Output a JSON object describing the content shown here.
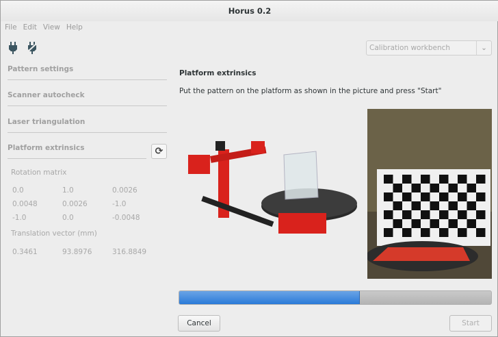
{
  "window": {
    "title": "Horus 0.2"
  },
  "menu": [
    "File",
    "Edit",
    "View",
    "Help"
  ],
  "toolbar": {
    "connect_icon": "plug-icon",
    "disconnect_icon": "plug-disconnected-icon"
  },
  "sidebar": {
    "sections": [
      "Pattern settings",
      "Scanner autocheck",
      "Laser triangulation",
      "Platform extrinsics"
    ],
    "rotation_label": "Rotation matrix",
    "rotation_matrix": [
      [
        "0.0",
        "1.0",
        "0.0026"
      ],
      [
        "0.0048",
        "0.0026",
        "-1.0"
      ],
      [
        "-1.0",
        "0.0",
        "-0.0048"
      ]
    ],
    "translation_label": "Translation vector (mm)",
    "translation_vector": [
      "0.3461",
      "93.8976",
      "316.8849"
    ]
  },
  "workbench": {
    "selected": "Calibration workbench"
  },
  "main": {
    "title": "Platform extrinsics",
    "instruction": "Put the pattern on the platform as shown in the picture and press \"Start\"",
    "progress_percent": 58,
    "cancel_label": "Cancel",
    "start_label": "Start"
  },
  "colors": {
    "accent": "#2a7ad8",
    "scanner_red": "#d9221c"
  }
}
